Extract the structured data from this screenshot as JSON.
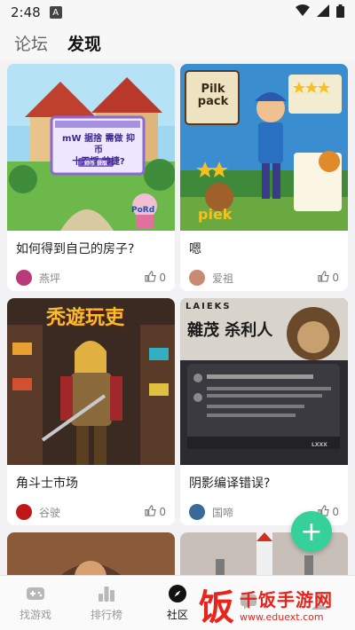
{
  "status_bar": {
    "time": "2:48",
    "badge": "A"
  },
  "top_tabs": [
    {
      "label": "论坛",
      "active": false
    },
    {
      "label": "发现",
      "active": true
    }
  ],
  "cards": [
    {
      "title": "如何得到自己的房子?",
      "author": "燕坪",
      "likes": "0",
      "image_texts": [
        "mW 据捨 需做 抑币",
        "十天捋 帅捷?",
        "帅币 获取",
        "PoRd"
      ],
      "avatar_color": "#b83a7a"
    },
    {
      "title": "嗯",
      "author": "爱祖",
      "likes": "0",
      "image_texts": [
        "Pilk pack",
        "piek"
      ],
      "avatar_color": "#c88a70"
    },
    {
      "title": "角斗士市场",
      "author": "谷驶",
      "likes": "0",
      "image_texts": [
        "秃遊玩吏"
      ],
      "avatar_color": "#c01818"
    },
    {
      "title": "阴影编译错误?",
      "author": "国啼",
      "likes": "0",
      "image_texts": [
        "LAIEKS",
        "雜茂 杀利人",
        "LXXX"
      ],
      "avatar_color": "#3a6a9a"
    }
  ],
  "bottom_nav": [
    {
      "label": "找游戏",
      "icon": "gamepad-icon",
      "active": false
    },
    {
      "label": "排行榜",
      "icon": "ranking-icon",
      "active": false
    },
    {
      "label": "社区",
      "icon": "compass-icon",
      "active": true
    },
    {
      "label": "",
      "icon": "chat-icon",
      "active": false
    },
    {
      "label": "",
      "icon": "profile-icon",
      "active": false
    }
  ],
  "watermark": {
    "logo": "饭",
    "title": "千饭手游网",
    "url": "www.eduext.com"
  },
  "fab": {
    "label": "+"
  },
  "colors": {
    "accent": "#36d19a",
    "tab_highlight": "#63d7c6",
    "watermark": "#e8251c"
  }
}
